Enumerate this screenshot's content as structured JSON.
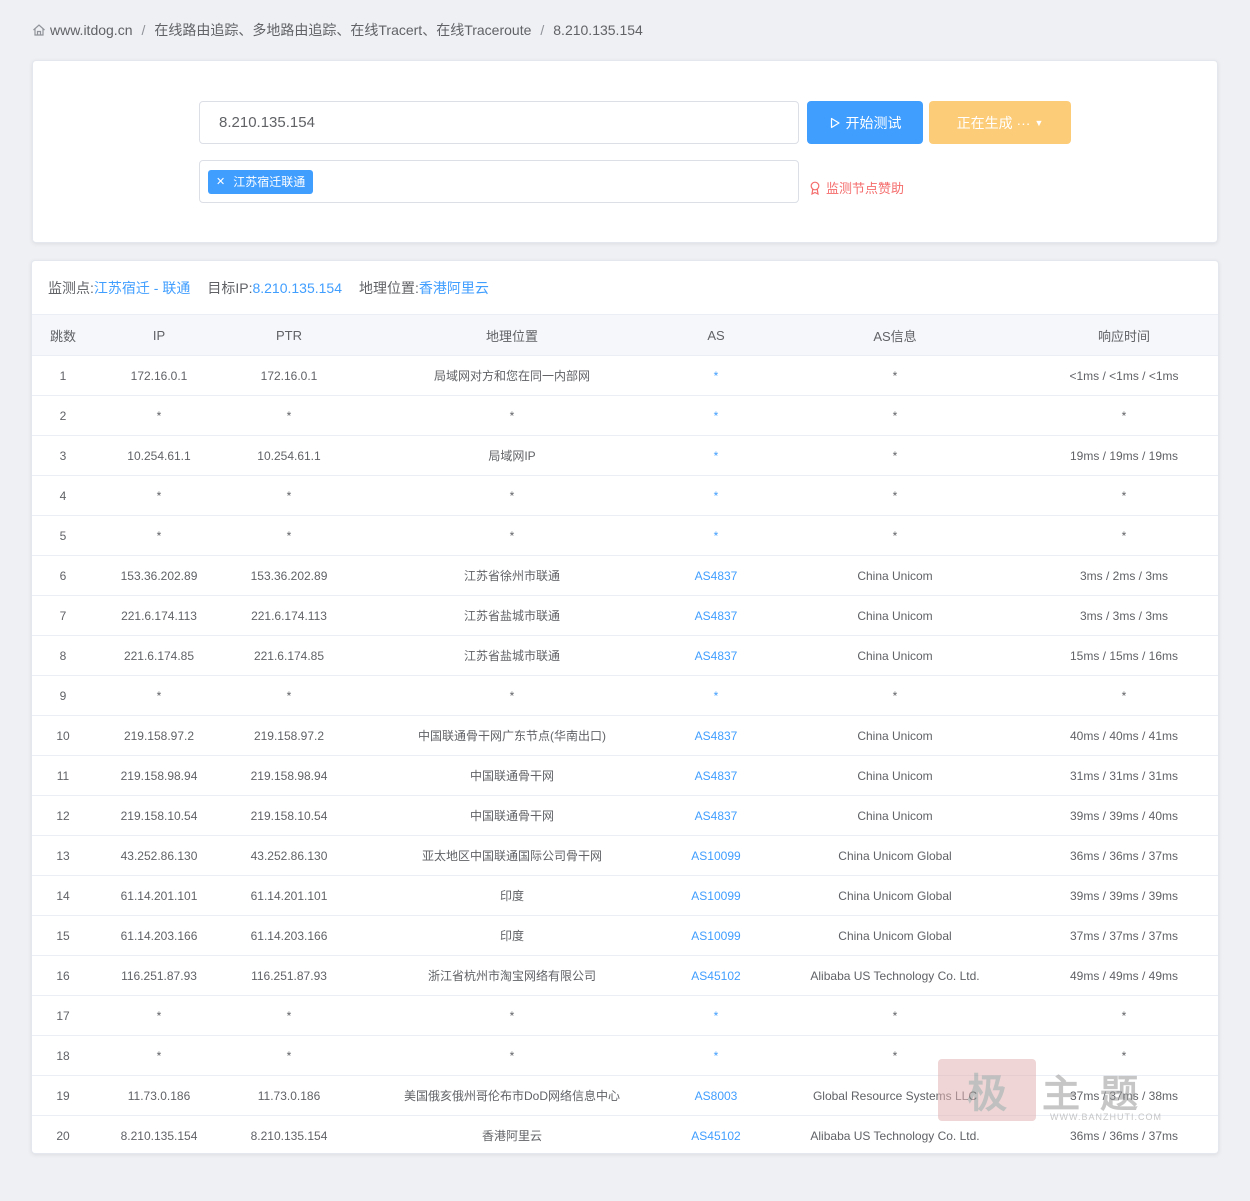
{
  "breadcrumb": {
    "site": "www.itdog.cn",
    "section": "在线路由追踪、多地路由追踪、在线Tracert、在线Traceroute",
    "current": "8.210.135.154"
  },
  "form": {
    "host_value": "8.210.135.154",
    "start_button": "开始测试",
    "generate_button": "正在生成 ···",
    "selected_node_tag": "江苏宿迁联通",
    "sponsor_link": "监测节点赞助"
  },
  "result": {
    "monitor_label": "监测点:",
    "monitor_value": "江苏宿迁 - 联通",
    "target_label": "目标IP:",
    "target_value": "8.210.135.154",
    "geo_label": "地理位置:",
    "geo_value": "香港阿里云",
    "columns": [
      "跳数",
      "IP",
      "PTR",
      "地理位置",
      "AS",
      "AS信息",
      "响应时间"
    ],
    "rows": [
      {
        "hop": "1",
        "ip": "172.16.0.1",
        "ptr": "172.16.0.1",
        "geo": "局域网对方和您在同一内部网",
        "as": "*",
        "as_info": "*",
        "time": "<1ms / <1ms / <1ms"
      },
      {
        "hop": "2",
        "ip": "*",
        "ptr": "*",
        "geo": "*",
        "as": "*",
        "as_info": "*",
        "time": "*"
      },
      {
        "hop": "3",
        "ip": "10.254.61.1",
        "ptr": "10.254.61.1",
        "geo": "局域网IP",
        "as": "*",
        "as_info": "*",
        "time": "19ms / 19ms / 19ms"
      },
      {
        "hop": "4",
        "ip": "*",
        "ptr": "*",
        "geo": "*",
        "as": "*",
        "as_info": "*",
        "time": "*"
      },
      {
        "hop": "5",
        "ip": "*",
        "ptr": "*",
        "geo": "*",
        "as": "*",
        "as_info": "*",
        "time": "*"
      },
      {
        "hop": "6",
        "ip": "153.36.202.89",
        "ptr": "153.36.202.89",
        "geo": "江苏省徐州市联通",
        "as": "AS4837",
        "as_info": "China Unicom",
        "time": "3ms / 2ms / 3ms"
      },
      {
        "hop": "7",
        "ip": "221.6.174.113",
        "ptr": "221.6.174.113",
        "geo": "江苏省盐城市联通",
        "as": "AS4837",
        "as_info": "China Unicom",
        "time": "3ms / 3ms / 3ms"
      },
      {
        "hop": "8",
        "ip": "221.6.174.85",
        "ptr": "221.6.174.85",
        "geo": "江苏省盐城市联通",
        "as": "AS4837",
        "as_info": "China Unicom",
        "time": "15ms / 15ms / 16ms"
      },
      {
        "hop": "9",
        "ip": "*",
        "ptr": "*",
        "geo": "*",
        "as": "*",
        "as_info": "*",
        "time": "*"
      },
      {
        "hop": "10",
        "ip": "219.158.97.2",
        "ptr": "219.158.97.2",
        "geo": "中国联通骨干网广东节点(华南出口)",
        "as": "AS4837",
        "as_info": "China Unicom",
        "time": "40ms / 40ms / 41ms"
      },
      {
        "hop": "11",
        "ip": "219.158.98.94",
        "ptr": "219.158.98.94",
        "geo": "中国联通骨干网",
        "as": "AS4837",
        "as_info": "China Unicom",
        "time": "31ms / 31ms / 31ms"
      },
      {
        "hop": "12",
        "ip": "219.158.10.54",
        "ptr": "219.158.10.54",
        "geo": "中国联通骨干网",
        "as": "AS4837",
        "as_info": "China Unicom",
        "time": "39ms / 39ms / 40ms"
      },
      {
        "hop": "13",
        "ip": "43.252.86.130",
        "ptr": "43.252.86.130",
        "geo": "亚太地区中国联通国际公司骨干网",
        "as": "AS10099",
        "as_info": "China Unicom Global",
        "time": "36ms / 36ms / 37ms"
      },
      {
        "hop": "14",
        "ip": "61.14.201.101",
        "ptr": "61.14.201.101",
        "geo": "印度",
        "as": "AS10099",
        "as_info": "China Unicom Global",
        "time": "39ms / 39ms / 39ms"
      },
      {
        "hop": "15",
        "ip": "61.14.203.166",
        "ptr": "61.14.203.166",
        "geo": "印度",
        "as": "AS10099",
        "as_info": "China Unicom Global",
        "time": "37ms / 37ms / 37ms"
      },
      {
        "hop": "16",
        "ip": "116.251.87.93",
        "ptr": "116.251.87.93",
        "geo": "浙江省杭州市淘宝网络有限公司",
        "as": "AS45102",
        "as_info": "Alibaba US Technology Co. Ltd.",
        "time": "49ms / 49ms / 49ms"
      },
      {
        "hop": "17",
        "ip": "*",
        "ptr": "*",
        "geo": "*",
        "as": "*",
        "as_info": "*",
        "time": "*"
      },
      {
        "hop": "18",
        "ip": "*",
        "ptr": "*",
        "geo": "*",
        "as": "*",
        "as_info": "*",
        "time": "*"
      },
      {
        "hop": "19",
        "ip": "11.73.0.186",
        "ptr": "11.73.0.186",
        "geo": "美国俄亥俄州哥伦布市DoD网络信息中心",
        "as": "AS8003",
        "as_info": "Global Resource Systems LLC",
        "time": "37ms / 37ms / 38ms"
      },
      {
        "hop": "20",
        "ip": "8.210.135.154",
        "ptr": "8.210.135.154",
        "geo": "香港阿里云",
        "as": "AS45102",
        "as_info": "Alibaba US Technology Co. Ltd.",
        "time": "36ms / 36ms / 37ms"
      }
    ]
  },
  "watermark": {
    "stamp": "极",
    "text": "主题",
    "url": "WWW.BANZHUTI.COM"
  },
  "colors": {
    "accent": "#409eff",
    "warning_button": "#fdcc78",
    "danger": "#f56c6c",
    "background": "#eef0f4"
  }
}
